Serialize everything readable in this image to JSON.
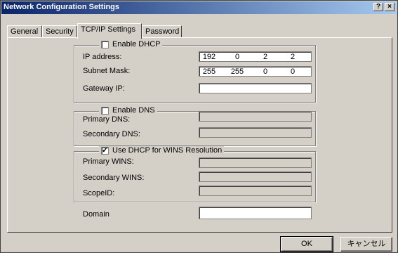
{
  "window": {
    "title": "Network Configuration Settings",
    "help_btn": "?",
    "close_btn": "×"
  },
  "tabs": [
    {
      "label": "General"
    },
    {
      "label": "Security"
    },
    {
      "label": "TCP/IP Settings"
    },
    {
      "label": "Password"
    }
  ],
  "dhcp": {
    "enable_label": "Enable DHCP",
    "checked": false,
    "ip_label": "IP address:",
    "ip": [
      "192",
      "0",
      "2",
      "2"
    ],
    "mask_label": "Subnet Mask:",
    "mask": [
      "255",
      "255",
      "0",
      "0"
    ],
    "gateway_label": "Gateway IP:",
    "gateway": ""
  },
  "dns": {
    "enable_label": "Enable DNS",
    "checked": false,
    "primary_label": "Primary DNS:",
    "secondary_label": "Secondary DNS:"
  },
  "wins": {
    "enable_label": "Use DHCP for WINS Resolution",
    "checked": true,
    "primary_label": "Primary WINS:",
    "secondary_label": "Secondary WINS:",
    "scope_label": "ScopeID:"
  },
  "domain": {
    "label": "Domain",
    "value": ""
  },
  "buttons": {
    "ok": "OK",
    "cancel": "キャンセル"
  }
}
